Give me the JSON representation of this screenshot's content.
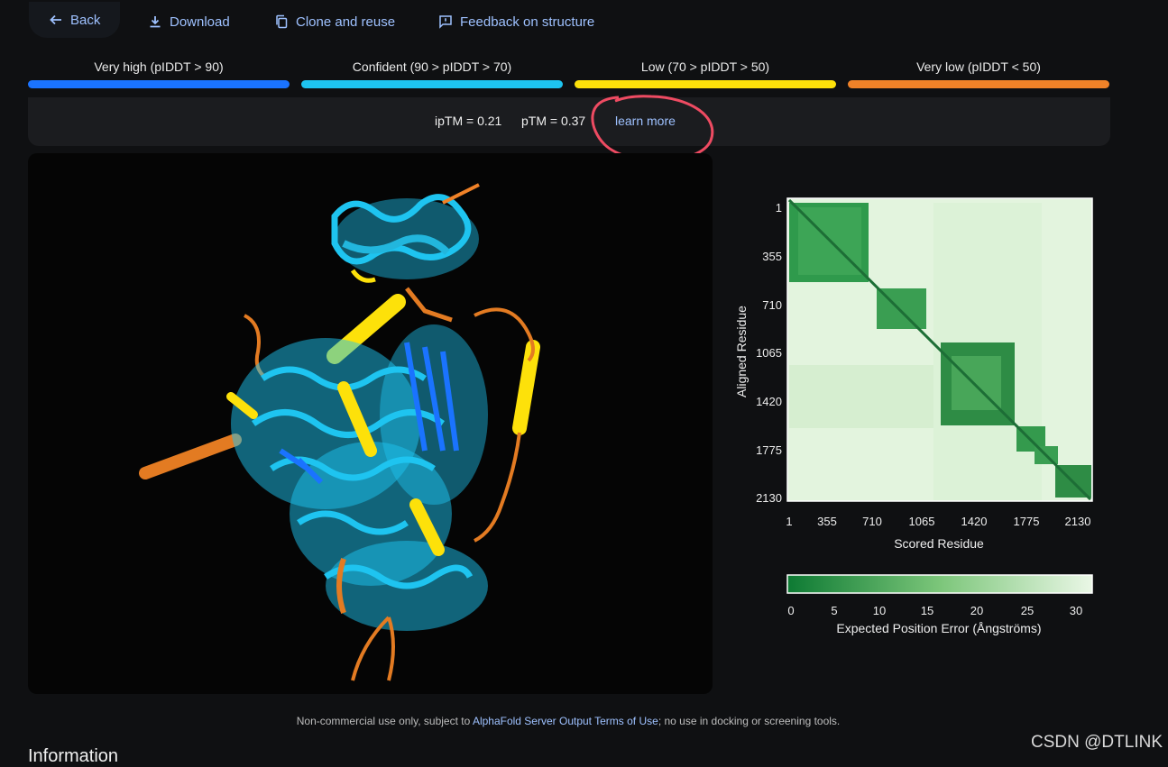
{
  "toolbar": {
    "back_label": "Back",
    "download_label": "Download",
    "clone_label": "Clone and reuse",
    "feedback_label": "Feedback on structure"
  },
  "legend": [
    {
      "label": "Very high (pIDDT > 90)",
      "color": "#1a73ff"
    },
    {
      "label": "Confident (90 > pIDDT > 70)",
      "color": "#1ec4f0"
    },
    {
      "label": "Low (70 > pIDDT > 50)",
      "color": "#fde10a"
    },
    {
      "label": "Very low (pIDDT < 50)",
      "color": "#f08228"
    }
  ],
  "metrics": {
    "iptm": "ipTM = 0.21",
    "ptm": "pTM = 0.37",
    "learn_more": "learn more"
  },
  "pae": {
    "ytick_labels": [
      "1",
      "355",
      "710",
      "1065",
      "1420",
      "1775",
      "2130"
    ],
    "xtick_labels": [
      "1",
      "355",
      "710",
      "1065",
      "1420",
      "1775",
      "2130"
    ],
    "ylabel": "Aligned Residue",
    "xlabel": "Scored Residue",
    "colorbar_ticks": [
      "0",
      "5",
      "10",
      "15",
      "20",
      "25",
      "30"
    ],
    "colorbar_label": "Expected Position Error (Ångströms)",
    "low_color": "#0d7a33",
    "high_color": "#eaf7e6"
  },
  "footer": {
    "prefix": "Non-commercial use only, subject to ",
    "link": "AlphaFold Server Output Terms of Use",
    "suffix": "; no use in docking or screening tools."
  },
  "section_title": "Information",
  "watermark": "CSDN @DTLINK"
}
